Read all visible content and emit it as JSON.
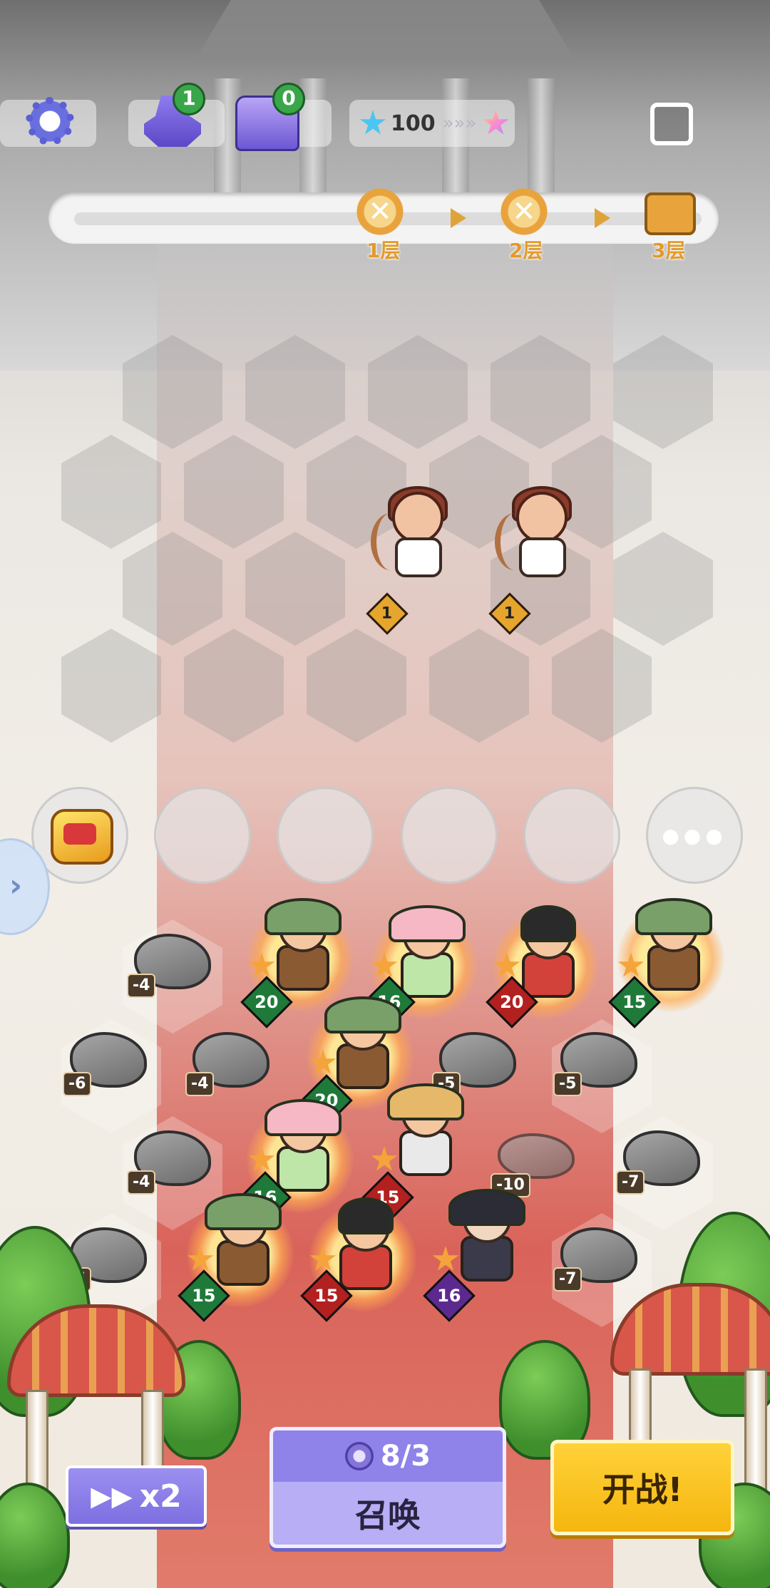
{
  "topbar": {
    "settings_icon": "gear-icon",
    "altar": {
      "icon": "anvil-icon",
      "count": "1"
    },
    "chest": {
      "icon": "chest-icon",
      "count": "0"
    },
    "stars": {
      "value": "100",
      "icon_from": "blue-star-icon",
      "icon_to": "rainbow-star-icon",
      "separator": "»»»"
    },
    "share_icon": "share-icon"
  },
  "progress": {
    "stages": [
      {
        "label": "1层",
        "icon": "crossed-swords-icon",
        "active": true
      },
      {
        "label": "2层",
        "icon": "crossed-swords-icon",
        "active": false
      },
      {
        "label": "3层",
        "icon": "treasure-chest-icon",
        "active": false
      }
    ]
  },
  "enemies": [
    {
      "type": "archer",
      "level": "1"
    },
    {
      "type": "archer",
      "level": "1"
    }
  ],
  "bench": {
    "item_icon": "golden-crown-icon",
    "more_label": "●●●",
    "expand_icon": "chevron-right-icon",
    "expand_label": "›"
  },
  "units": [
    {
      "type": "axe-warrior",
      "stars": 1,
      "power": "20",
      "tag_color": "#1f7a3a"
    },
    {
      "type": "mushroom-fairy",
      "stars": 1,
      "power": "16",
      "tag_color": "#1f7a3a"
    },
    {
      "type": "spear-girl",
      "stars": 1,
      "power": "20",
      "tag_color": "#b22020"
    },
    {
      "type": "axe-warrior",
      "stars": 1,
      "power": "15",
      "tag_color": "#1f7a3a"
    },
    {
      "type": "axe-warrior",
      "stars": 1,
      "power": "20",
      "tag_color": "#1f7a3a"
    },
    {
      "type": "mushroom-fairy",
      "stars": 1,
      "power": "16",
      "tag_color": "#1f7a3a"
    },
    {
      "type": "straw-hat-monk",
      "stars": 1,
      "power": "15",
      "tag_color": "#b22020"
    },
    {
      "type": "axe-warrior",
      "stars": 1,
      "power": "15",
      "tag_color": "#1f7a3a"
    },
    {
      "type": "spear-girl",
      "stars": 1,
      "power": "15",
      "tag_color": "#b22020"
    },
    {
      "type": "witch-hat-mage",
      "stars": 1,
      "power": "16",
      "tag_color": "#5c2a8f"
    }
  ],
  "rocks": [
    "-4",
    "-6",
    "-4",
    "-5",
    "-5",
    "-4",
    "-10",
    "-7",
    "-5",
    "-7"
  ],
  "buttons": {
    "speed": "x2",
    "speed_icon": "fast-forward-icon",
    "summon_cost": "8/3",
    "summon_label": "召唤",
    "fight_label": "开战!"
  }
}
